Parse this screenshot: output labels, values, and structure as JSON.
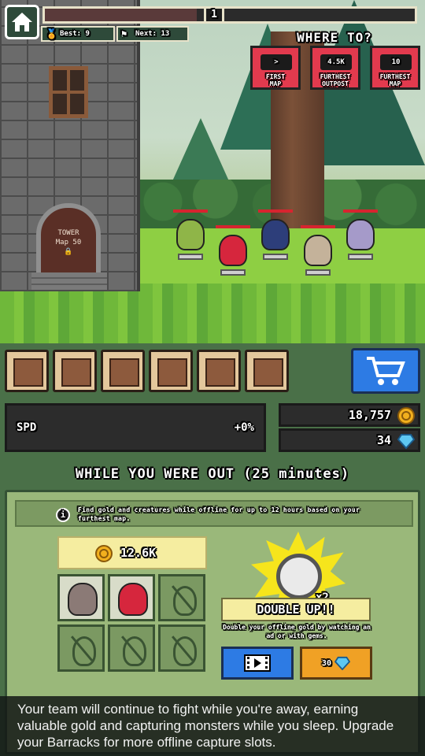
{
  "hud": {
    "level": "1",
    "progress_fraction": 0.41,
    "best_label": "Best: 9",
    "next_label": "Next: 13"
  },
  "where_to": {
    "title": "WHERE TO?",
    "destinations": [
      {
        "top": ">",
        "label_line1": "FIRST",
        "label_line2": "MAP"
      },
      {
        "top": "4.5K",
        "label_line1": "FURTHEST",
        "label_line2": "OUTPOST"
      },
      {
        "top": "10",
        "label_line1": "FURTHEST",
        "label_line2": "MAP"
      }
    ]
  },
  "tower": {
    "line1": "TOWER",
    "line2": "Map 50"
  },
  "stats": {
    "spd_label": "SPD",
    "spd_value": "+0%",
    "gold": "18,757",
    "gems": "34"
  },
  "offline": {
    "title": "WHILE YOU WERE OUT (25 minutes)",
    "info": "Find gold and creatures while offline for up to 12 hours based on your furthest map.",
    "gold_earned": "12.6K",
    "double_title": "DOUBLE UP!!",
    "multiplier": "x2",
    "double_desc": "Double your offline gold by watching an ad or with gems.",
    "gem_cost": "30"
  },
  "tooltip": {
    "text": "Your team will continue to fight while you're away, earning valuable gold and capturing monsters while you sleep. Upgrade your Barracks for more offline capture slots."
  },
  "colors": {
    "red_button": "#e23a4e",
    "blue_button": "#2d7be4",
    "gold_button": "#f0a125",
    "panel_green": "#4a7048",
    "grass": "#8ecf43"
  }
}
